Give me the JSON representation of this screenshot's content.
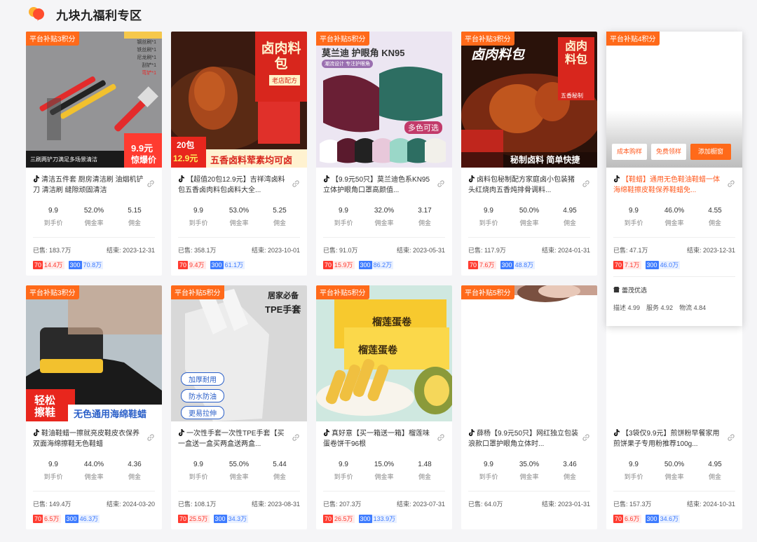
{
  "page": {
    "title": "九块九福利专区"
  },
  "products": [
    {
      "badge": "平台补贴3积分",
      "name": "清洁五件套 厨房清洁刷 油烟机铲刀 清洁刷 缝隙顽固清洁",
      "price": "9.9",
      "rate": "52.0%",
      "commission": "5.15",
      "sold": "已售: 183.7万",
      "end": "结束: 2023-12-31",
      "tag_red_k": "70",
      "tag_red_v": "14.4万",
      "tag_blue_k": "300",
      "tag_blue_v": "70.8万",
      "img_texts": [
        "9.9元",
        "惊爆价",
        "三刷两铲刀满足多场景清洁",
        "钢丝刷*1",
        "铁丝刷*1",
        "尼龙刷*1",
        "刮铲*1",
        "弯铲*1"
      ]
    },
    {
      "badge": "",
      "name": "【超值20包12.9元】吉祥湾卤料包五香卤肉料包卤料大全...",
      "price": "9.9",
      "rate": "53.0%",
      "commission": "5.25",
      "sold": "已售: 358.1万",
      "end": "结束: 2023-10-01",
      "tag_red_k": "70",
      "tag_red_v": "9.4万",
      "tag_blue_k": "300",
      "tag_blue_v": "61.1万",
      "img_texts": [
        "卤肉料包",
        "老店配方",
        "20包",
        "12.9元",
        "五香卤料荤素均可卤"
      ]
    },
    {
      "badge": "平台补贴5积分",
      "name": "【9.9元50只】莫兰迪色系KN95立体护眼角口罩高颜值...",
      "price": "9.9",
      "rate": "32.0%",
      "commission": "3.17",
      "sold": "已售: 91.0万",
      "end": "结束: 2023-05-31",
      "tag_red_k": "70",
      "tag_red_v": "15.9万",
      "tag_blue_k": "300",
      "tag_blue_v": "86.2万",
      "img_texts": [
        "莫兰迪 护眼角 KN95",
        "潮流设计 专注护眼角",
        "多色可选"
      ]
    },
    {
      "badge": "平台补贴3积分",
      "name": "卤料包秘制配方家庭卤小包装猪头红烧肉五香炖排骨调料...",
      "price": "9.9",
      "rate": "50.0%",
      "commission": "4.95",
      "sold": "已售: 117.9万",
      "end": "结束: 2024-01-31",
      "tag_red_k": "70",
      "tag_red_v": "7.6万",
      "tag_blue_k": "300",
      "tag_blue_v": "48.8万",
      "img_texts": [
        "卤肉料包",
        "卤肉料包",
        "五香秘制",
        "秘制卤料 简单快捷"
      ]
    },
    {
      "badge": "平台补贴3积分",
      "name": "鞋油鞋蜡一擦就亮皮鞋皮衣保养双面海绵擦鞋无色鞋蜡",
      "price": "9.9",
      "rate": "44.0%",
      "commission": "4.36",
      "sold": "已售: 149.4万",
      "end": "结束: 2024-03-20",
      "tag_red_k": "70",
      "tag_red_v": "6.5万",
      "tag_blue_k": "300",
      "tag_blue_v": "46.3万",
      "img_texts": [
        "轻松擦鞋",
        "无色通用海绵鞋蜡"
      ]
    },
    {
      "badge": "平台补贴5积分",
      "name": "一次性手套一次性TPE手套【买一盒送一盒买两盒送两盒...",
      "price": "9.9",
      "rate": "55.0%",
      "commission": "5.44",
      "sold": "已售: 108.1万",
      "end": "结束: 2023-08-31",
      "tag_red_k": "70",
      "tag_red_v": "25.5万",
      "tag_blue_k": "300",
      "tag_blue_v": "34.3万",
      "img_texts": [
        "居家必备",
        "TPE手套",
        "加厚耐用",
        "防水防油",
        "更易拉伸"
      ]
    },
    {
      "badge": "平台补贴5积分",
      "name": "真好意【买一箱送一箱】榴莲味蛋卷饼干96根",
      "price": "9.9",
      "rate": "15.0%",
      "commission": "1.48",
      "sold": "已售: 207.3万",
      "end": "结束: 2023-07-31",
      "tag_red_k": "70",
      "tag_red_v": "26.5万",
      "tag_blue_k": "300",
      "tag_blue_v": "133.9万",
      "img_texts": [
        "榴莲蛋卷",
        "榴莲蛋卷"
      ]
    },
    {
      "badge": "平台补贴5积分",
      "name": "薛杨【9.9元50只】网红独立包装浪款口罩护眼角立体时...",
      "price": "9.9",
      "rate": "35.0%",
      "commission": "3.46",
      "sold": "已售: 64.0万",
      "end": "结束: 2023-01-31",
      "tag_red_k": "",
      "tag_red_v": "",
      "tag_blue_k": "",
      "tag_blue_v": "",
      "img_texts": []
    },
    {
      "badge": "",
      "name": "【3袋仅9.9元】煎饼粉早餐家用煎饼果子专用粉推荐100g...",
      "price": "9.9",
      "rate": "50.0%",
      "commission": "4.95",
      "sold": "已售: 157.3万",
      "end": "结束: 2024-10-31",
      "tag_red_k": "70",
      "tag_red_v": "6.6万",
      "tag_blue_k": "300",
      "tag_blue_v": "34.6万",
      "img_texts": []
    }
  ],
  "stat_labels": {
    "price": "到手价",
    "rate": "佣金率",
    "commission": "佣金"
  },
  "hover": {
    "badge": "平台补贴4积分",
    "name": "【鞋蜡】通用无色鞋油鞋蜡一体海绵鞋擦皮鞋保养鞋蜡免...",
    "price": "9.9",
    "rate": "46.0%",
    "commission": "4.55",
    "sold": "已售: 47.1万",
    "end": "结束: 2023-12-31",
    "tag_red_k": "70",
    "tag_red_v": "7.1万",
    "tag_blue_k": "300",
    "tag_blue_v": "46.0万",
    "btn_cost": "成本购样",
    "btn_free": "免费领样",
    "btn_add": "添加橱窗",
    "shop_name": "蕾茂优选",
    "score_desc": "描述 4.99",
    "score_service": "服务 4.92",
    "score_logistics": "物流 4.84"
  },
  "colors": {
    "accent": "#ff6a1a",
    "red_tag": "#ff3b30",
    "blue_tag": "#3d7bff"
  }
}
